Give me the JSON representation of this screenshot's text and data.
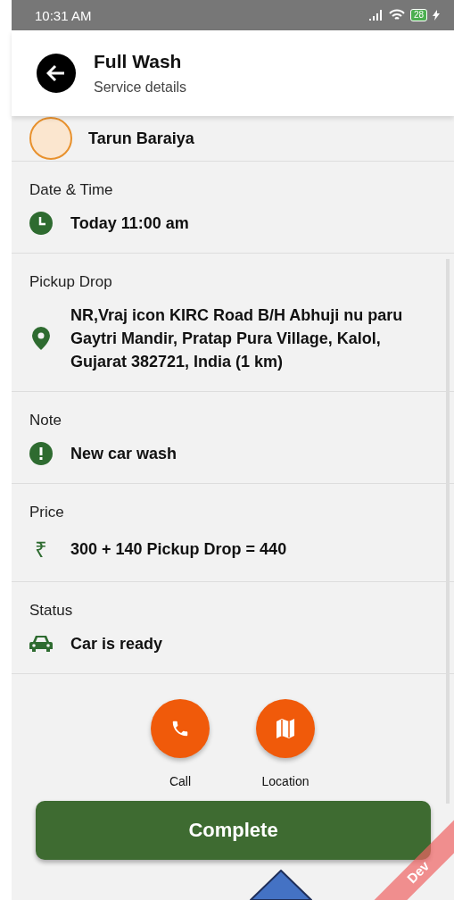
{
  "status_bar": {
    "time": "10:31 AM",
    "battery": "28"
  },
  "header": {
    "title": "Full Wash",
    "subtitle": "Service details"
  },
  "customer": {
    "name": "Tarun Baraiya"
  },
  "sections": [
    {
      "label": "Date & Time",
      "value": "Today 11:00 am",
      "kind": "clock"
    },
    {
      "label": "Pickup Drop",
      "value": "NR,Vraj icon KIRC Road B/H Abhuji nu paru Gaytri Mandir, Pratap Pura Village, Kalol, Gujarat 382721, India  (1 km)",
      "kind": "pin"
    },
    {
      "label": "Note",
      "value": "New car wash",
      "kind": "alert"
    },
    {
      "label": "Price",
      "value": "300 + 140 Pickup Drop = 440",
      "kind": "symbol",
      "symbol": "₹"
    },
    {
      "label": "Status",
      "value": "Car is ready",
      "kind": "car"
    }
  ],
  "actions": [
    {
      "label": "Call",
      "kind": "phone"
    },
    {
      "label": "Location",
      "kind": "map"
    }
  ],
  "primary_button": "Complete",
  "ribbon": "Dev"
}
